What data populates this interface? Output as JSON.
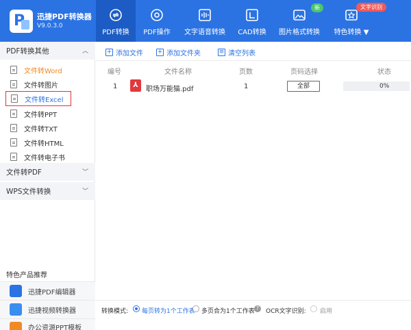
{
  "app": {
    "name": "迅捷PDF转换器",
    "version": "V9.0.3.0"
  },
  "nav": {
    "tabs": [
      {
        "label": "PDF转换",
        "icon": "convert-icon"
      },
      {
        "label": "PDF操作",
        "icon": "gear-icon"
      },
      {
        "label": "文字语音转换",
        "icon": "audio-icon"
      },
      {
        "label": "CAD转换",
        "icon": "cad-icon"
      },
      {
        "label": "图片格式转换",
        "icon": "image-icon"
      },
      {
        "label": "特色转换",
        "icon": "star-icon"
      }
    ],
    "badge_new": "新",
    "badge_ocr": "文字识别"
  },
  "sidebar": {
    "group1": "PDF转换其他",
    "items": [
      {
        "label": "文件转Word"
      },
      {
        "label": "文件转图片"
      },
      {
        "label": "文件转Excel"
      },
      {
        "label": "文件转PPT"
      },
      {
        "label": "文件转TXT"
      },
      {
        "label": "文件转HTML"
      },
      {
        "label": "文件转电子书"
      }
    ],
    "group2": "文件转PDF",
    "group3": "WPS文件转换",
    "feature_title": "特色产品推荐",
    "products": [
      {
        "label": "迅捷PDF编辑器"
      },
      {
        "label": "迅捷视频转换器"
      },
      {
        "label": "办公资源PPT模板"
      }
    ]
  },
  "toolbar": {
    "add_file": "添加文件",
    "add_folder": "添加文件夹",
    "clear_list": "清空列表"
  },
  "table": {
    "headers": [
      "编号",
      "文件名称",
      "页数",
      "页码选择",
      "状态"
    ],
    "rows": [
      {
        "index": "1",
        "filename": "职场万能猫.pdf",
        "pages": "1",
        "page_select": "全部",
        "progress": "0%"
      }
    ]
  },
  "bottom": {
    "mode_label": "转换模式:",
    "option1": "每页转为1个工作表",
    "option2": "多页合为1个工作表",
    "ocr_label": "OCR文字识别:",
    "enable": "启用"
  },
  "colors": {
    "brand": "#2b73e3",
    "active_tab": "#1d5cc4",
    "highlight_box": "#e03434",
    "word_orange": "#f08a24"
  }
}
